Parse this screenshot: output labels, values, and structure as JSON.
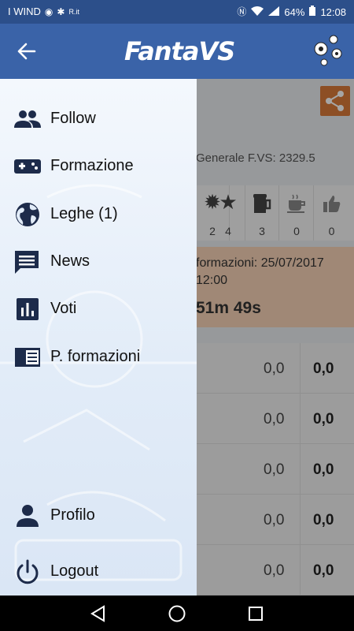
{
  "status_bar": {
    "carrier": "I WIND",
    "battery": "64%",
    "time": "12:08",
    "small_label": "R.it"
  },
  "app_bar": {
    "logo_text": "FantaVS",
    "back_icon": "arrow-back-icon",
    "right_icon": "soccer-balls-icon"
  },
  "background_page": {
    "general_text": "Generale F.VS: 2329.5",
    "stats": [
      {
        "icon": "badge-icon",
        "value": "2"
      },
      {
        "icon": "star-icon",
        "value": "4"
      },
      {
        "icon": "beer-icon",
        "value": "3"
      },
      {
        "icon": "coffee-icon",
        "value": "0"
      },
      {
        "icon": "thumb-up-icon",
        "value": "0"
      }
    ],
    "deadline_line1": "formazioni: 25/07/2017",
    "deadline_line2": "12:00",
    "countdown": "51m 49s",
    "rows": [
      {
        "v1": "0,0",
        "v2": "0,0"
      },
      {
        "v1": "0,0",
        "v2": "0,0"
      },
      {
        "v1": "0,0",
        "v2": "0,0"
      },
      {
        "v1": "0,0",
        "v2": "0,0"
      },
      {
        "v1": "0,0",
        "v2": "0,0"
      }
    ]
  },
  "drawer": {
    "items": [
      {
        "label": "Follow",
        "icon": "people-icon"
      },
      {
        "label": "Formazione",
        "icon": "gamepad-icon"
      },
      {
        "label": "Leghe  (1)",
        "icon": "globe-icon"
      },
      {
        "label": "News",
        "icon": "chat-icon"
      },
      {
        "label": "Voti",
        "icon": "bar-chart-icon"
      },
      {
        "label": "P. formazioni",
        "icon": "document-icon"
      }
    ],
    "bottom_items": [
      {
        "label": "Profilo",
        "icon": "person-icon"
      },
      {
        "label": "Logout",
        "icon": "power-icon"
      }
    ]
  },
  "nav_bar": {
    "back": "nav-back-icon",
    "home": "nav-home-icon",
    "recents": "nav-recents-icon"
  },
  "colors": {
    "status_bar": "#2c4f8a",
    "app_bar": "#3a63a8",
    "icon_dark": "#1d2b4a",
    "share_orange": "#d97a3a"
  }
}
